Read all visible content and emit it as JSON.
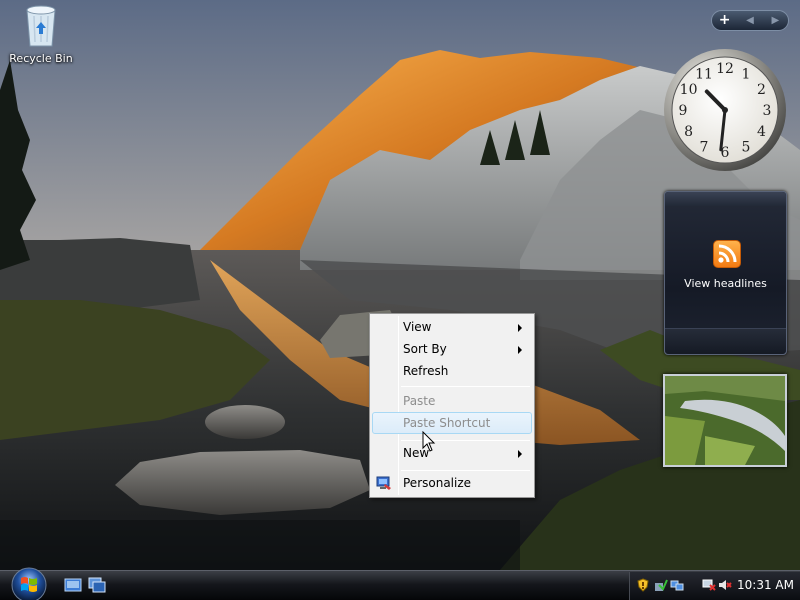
{
  "desktop": {
    "recycle_bin_label": "Recycle Bin"
  },
  "sidebar": {
    "add_gadget_symbol": "+",
    "prev_symbol": "◀",
    "next_symbol": "▶",
    "clock_numerals": [
      "12",
      "1",
      "2",
      "3",
      "4",
      "5",
      "6",
      "7",
      "8",
      "9",
      "10",
      "11"
    ],
    "clock_time": {
      "hour": 10,
      "minute": 31
    },
    "feed_headlines_label": "View headlines"
  },
  "context_menu": {
    "items": [
      {
        "label": "View",
        "has_submenu": true,
        "enabled": true
      },
      {
        "label": "Sort By",
        "has_submenu": true,
        "enabled": true
      },
      {
        "label": "Refresh",
        "has_submenu": false,
        "enabled": true
      },
      {
        "label": "Paste",
        "has_submenu": false,
        "enabled": false
      },
      {
        "label": "Paste Shortcut",
        "has_submenu": false,
        "enabled": false,
        "hovered": true
      },
      {
        "label": "New",
        "has_submenu": true,
        "enabled": true
      },
      {
        "label": "Personalize",
        "has_submenu": false,
        "enabled": true,
        "icon": "personalize-icon"
      }
    ]
  },
  "taskbar": {
    "quick_launch": [
      "show-desktop-icon",
      "switch-windows-icon"
    ],
    "tray_icons": [
      "security-shield-icon",
      "windows-defender-icon",
      "network-icon",
      "power-icon",
      "volume-muted-icon"
    ],
    "time": "10:31 AM"
  },
  "colors": {
    "accent_rss": "#f27a12",
    "menu_bg": "#f1f1f1",
    "menu_hover_border": "#a8d8f4",
    "taskbar_bg": "#15171c"
  }
}
